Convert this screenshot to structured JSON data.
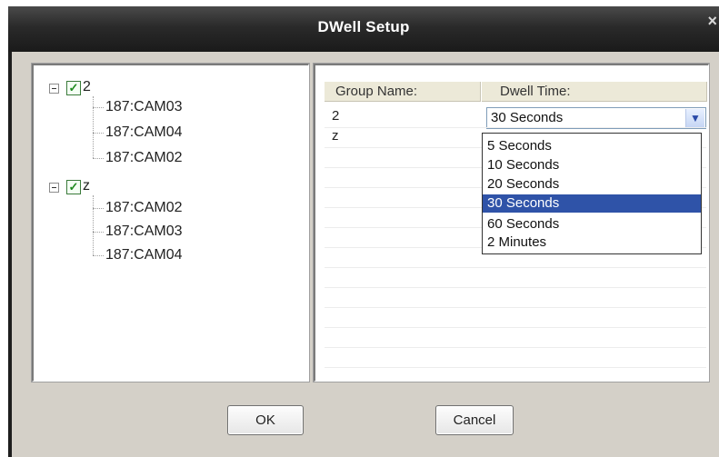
{
  "dialog": {
    "title": "DWell Setup",
    "close_glyph": "×"
  },
  "tree": {
    "groups": [
      {
        "name": "2",
        "expander": "minus",
        "checked": true,
        "cameras": [
          "187:CAM03",
          "187:CAM04",
          "187:CAM02"
        ]
      },
      {
        "name": "z",
        "expander": "minus",
        "checked": true,
        "cameras": [
          "187:CAM02",
          "187:CAM03",
          "187:CAM04"
        ]
      }
    ]
  },
  "grid": {
    "headers": {
      "group_name": "Group Name:",
      "dwell_time": "Dwell Time:"
    },
    "rows": [
      {
        "group": "2",
        "dwell": "30 Seconds"
      },
      {
        "group": "z",
        "dwell": ""
      }
    ]
  },
  "dropdown": {
    "options": [
      "5 Seconds",
      "10 Seconds",
      "20 Seconds",
      "30 Seconds",
      "60 Seconds",
      "2 Minutes"
    ],
    "selected": "30 Seconds"
  },
  "buttons": {
    "ok": "OK",
    "cancel": "Cancel"
  },
  "colors": {
    "selection": "#2f53a8",
    "checkmark": "#1f8a1f",
    "titlebar": "#2a2a2a"
  }
}
